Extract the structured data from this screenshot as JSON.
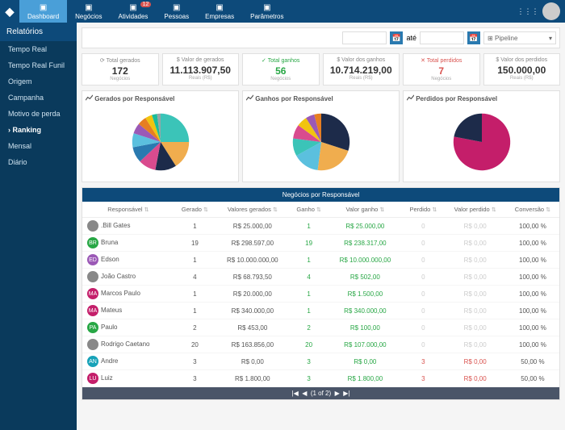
{
  "nav": {
    "items": [
      {
        "label": "Dashboard",
        "active": true
      },
      {
        "label": "Negócios"
      },
      {
        "label": "Atividades",
        "badge": "12"
      },
      {
        "label": "Pessoas"
      },
      {
        "label": "Empresas"
      },
      {
        "label": "Parâmetros"
      }
    ]
  },
  "sidebar": {
    "header": "Relatórios",
    "items": [
      "Tempo Real",
      "Tempo Real Funil",
      "Origem",
      "Campanha",
      "Motivo de perda",
      "Ranking",
      "Mensal",
      "Diário"
    ],
    "active": "Ranking"
  },
  "filters": {
    "sep": "até",
    "pipeline": "Pipeline"
  },
  "kpi": [
    {
      "label": "⟳ Total gerados",
      "value": "172",
      "sub": "Negócios"
    },
    {
      "label": "$ Valor de gerados",
      "value": "11.113.907,50",
      "sub": "Reais (R$)"
    },
    {
      "label": "✓ Total ganhos",
      "value": "56",
      "sub": "Negócios",
      "cls": "green"
    },
    {
      "label": "$ Valor dos ganhos",
      "value": "10.714.219,00",
      "sub": "Reais (R$)"
    },
    {
      "label": "✕ Total perdidos",
      "value": "7",
      "sub": "Negócios",
      "cls": "red"
    },
    {
      "label": "$ Valor dos perdidos",
      "value": "150.000,00",
      "sub": "Reais (R$)"
    }
  ],
  "charts": [
    {
      "title": "Gerados por Responsável"
    },
    {
      "title": "Ganhos por Responsável"
    },
    {
      "title": "Perdidos por Responsável"
    }
  ],
  "chart_data": [
    {
      "type": "pie",
      "title": "Gerados por Responsável",
      "values": [
        25,
        16,
        12,
        10,
        9,
        8,
        6,
        5,
        4,
        3,
        2
      ],
      "colors": [
        "#3bc4b8",
        "#f0ad4e",
        "#1d2b4a",
        "#d94b8e",
        "#2a7ab0",
        "#5bc0de",
        "#9b59b6",
        "#e67e22",
        "#f1c40f",
        "#1abc9c",
        "#95a5a6"
      ]
    },
    {
      "type": "pie",
      "title": "Ganhos por Responsável",
      "values": [
        30,
        22,
        15,
        10,
        8,
        6,
        5,
        4
      ],
      "colors": [
        "#1d2b4a",
        "#f0ad4e",
        "#5bc0de",
        "#3bc4b8",
        "#d94b8e",
        "#f1c40f",
        "#9b59b6",
        "#e67e22"
      ]
    },
    {
      "type": "pie",
      "title": "Perdidos por Responsável",
      "values": [
        78,
        22
      ],
      "colors": [
        "#c41e6a",
        "#1d2b4a"
      ]
    }
  ],
  "table": {
    "title": "Negócios por Responsável",
    "headers": [
      "Responsável",
      "Gerado",
      "Valores gerados",
      "Ganho",
      "Valor ganho",
      "Perdido",
      "Valor perdido",
      "Conversão"
    ],
    "rows": [
      {
        "av": "",
        "avc": "#888",
        "n": ".Bill Gates",
        "g": "1",
        "vg": "R$ 25.000,00",
        "ga": "1",
        "vga": "R$ 25.000,00",
        "p": "0",
        "vp": "R$ 0,00",
        "c": "100,00 %"
      },
      {
        "av": "BR",
        "avc": "#28a745",
        "n": "Bruna",
        "g": "19",
        "vg": "R$ 298.597,00",
        "ga": "19",
        "vga": "R$ 238.317,00",
        "p": "0",
        "vp": "R$ 0,00",
        "c": "100,00 %"
      },
      {
        "av": "ED",
        "avc": "#9b59b6",
        "n": "Edson",
        "g": "1",
        "vg": "R$ 10.000.000,00",
        "ga": "1",
        "vga": "R$ 10.000.000,00",
        "p": "0",
        "vp": "R$ 0,00",
        "c": "100,00 %"
      },
      {
        "av": "",
        "avc": "#888",
        "n": "João Castro",
        "g": "4",
        "vg": "R$ 68.793,50",
        "ga": "4",
        "vga": "R$ 502,00",
        "p": "0",
        "vp": "R$ 0,00",
        "c": "100,00 %"
      },
      {
        "av": "MA",
        "avc": "#c41e6a",
        "n": "Marcos Paulo",
        "g": "1",
        "vg": "R$ 20.000,00",
        "ga": "1",
        "vga": "R$ 1.500,00",
        "p": "0",
        "vp": "R$ 0,00",
        "c": "100,00 %"
      },
      {
        "av": "MA",
        "avc": "#c41e6a",
        "n": "Mateus",
        "g": "1",
        "vg": "R$ 340.000,00",
        "ga": "1",
        "vga": "R$ 340.000,00",
        "p": "0",
        "vp": "R$ 0,00",
        "c": "100,00 %"
      },
      {
        "av": "PA",
        "avc": "#28a745",
        "n": "Paulo",
        "g": "2",
        "vg": "R$ 453,00",
        "ga": "2",
        "vga": "R$ 100,00",
        "p": "0",
        "vp": "R$ 0,00",
        "c": "100,00 %"
      },
      {
        "av": "",
        "avc": "#888",
        "n": "Rodrigo Caetano",
        "g": "20",
        "vg": "R$ 163.856,00",
        "ga": "20",
        "vga": "R$ 107.000,00",
        "p": "0",
        "vp": "R$ 0,00",
        "c": "100,00 %"
      },
      {
        "av": "AN",
        "avc": "#17a2b8",
        "n": "Andre",
        "g": "3",
        "vg": "R$ 0,00",
        "ga": "3",
        "vga": "R$ 0,00",
        "p": "3",
        "vp": "R$ 0,00",
        "c": "50,00 %"
      },
      {
        "av": "LU",
        "avc": "#c41e6a",
        "n": "Luiz",
        "g": "3",
        "vg": "R$ 1.800,00",
        "ga": "3",
        "vga": "R$ 1.800,00",
        "p": "3",
        "vp": "R$ 0,00",
        "c": "50,00 %"
      }
    ]
  },
  "pager": "(1 of 2)"
}
